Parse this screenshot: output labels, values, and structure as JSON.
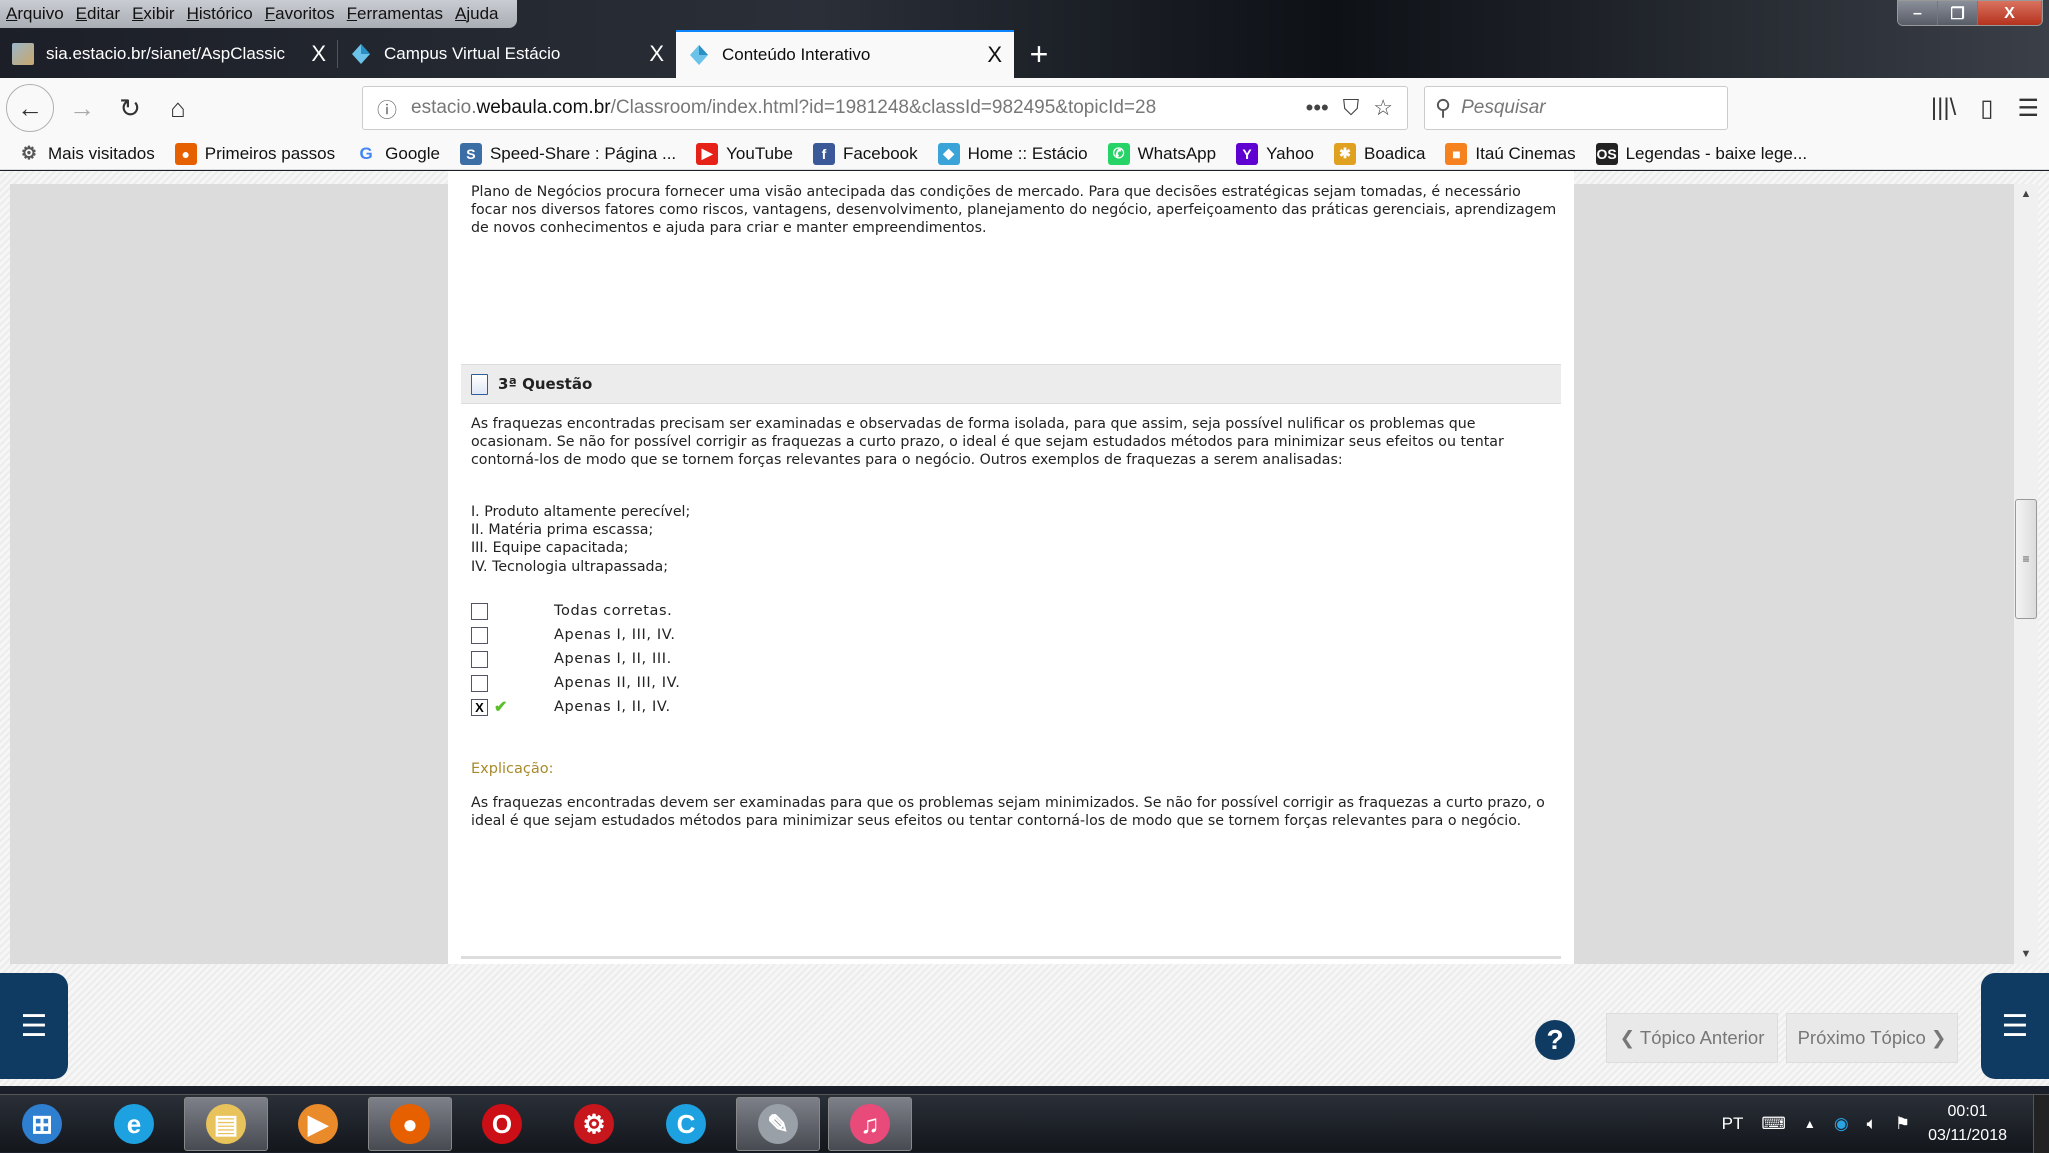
{
  "browser": {
    "menu": [
      "Arquivo",
      "Editar",
      "Exibir",
      "Histórico",
      "Favoritos",
      "Ferramentas",
      "Ajuda"
    ],
    "window_controls": {
      "minimize": "–",
      "restore": "❐",
      "close": "X"
    },
    "tabs": [
      {
        "label": "sia.estacio.br/sianet/AspClassic",
        "close": "X",
        "active": false
      },
      {
        "label": "Campus Virtual Estácio",
        "close": "X",
        "active": false
      },
      {
        "label": "Conteúdo Interativo",
        "close": "X",
        "active": true
      }
    ],
    "new_tab": "+",
    "nav": {
      "back": "←",
      "forward": "→",
      "reload": "C",
      "home": "⌂"
    },
    "url": {
      "prefix": "estacio.",
      "domain": "webaula.com.br",
      "path": "/Classroom/index.html?id=1981248&classId=982495&topicId=28"
    },
    "url_actions": {
      "more": "•••",
      "pocket": "⛉",
      "bookmark": "☆"
    },
    "search": {
      "placeholder": "Pesquisar",
      "icon": "search-icon"
    },
    "toolbar_right": {
      "library": "|||\\",
      "sidebar": "▯",
      "menu": "☰"
    },
    "bookmarks": [
      {
        "label": "Mais visitados",
        "icon": "gear-icon",
        "glyph": "⚙",
        "color": "#555555"
      },
      {
        "label": "Primeiros passos",
        "icon": "firefox-icon",
        "glyph": "●",
        "color": "#e66000"
      },
      {
        "label": "Google",
        "icon": "google-icon",
        "glyph": "G",
        "color": "#4285f4"
      },
      {
        "label": "Speed-Share : Página ...",
        "icon": "speedshare-icon",
        "glyph": "S",
        "color": "#3a6ea5"
      },
      {
        "label": "YouTube",
        "icon": "youtube-icon",
        "glyph": "▶",
        "color": "#e62117"
      },
      {
        "label": "Facebook",
        "icon": "facebook-icon",
        "glyph": "f",
        "color": "#3b5998"
      },
      {
        "label": "Home :: Estácio",
        "icon": "estacio-icon",
        "glyph": "◆",
        "color": "#3aa3d8"
      },
      {
        "label": "WhatsApp",
        "icon": "whatsapp-icon",
        "glyph": "✆",
        "color": "#25d366"
      },
      {
        "label": "Yahoo",
        "icon": "yahoo-icon",
        "glyph": "Y",
        "color": "#5f01d1"
      },
      {
        "label": "Boadica",
        "icon": "boadica-icon",
        "glyph": "✱",
        "color": "#e0a020"
      },
      {
        "label": "Itaú Cinemas",
        "icon": "itau-icon",
        "glyph": "■",
        "color": "#f5821f"
      },
      {
        "label": "Legendas - baixe lege...",
        "icon": "legendas-icon",
        "glyph": "OS",
        "color": "#222222"
      }
    ]
  },
  "page": {
    "intro": "Plano de Negócios procura fornecer uma visão antecipada das condições de mercado. Para que decisões estratégicas sejam tomadas, é necessário focar nos diversos fatores como riscos, vantagens, desenvolvimento, planejamento do negócio, aperfeiçoamento das práticas gerenciais, aprendizagem de novos conhecimentos e ajuda para criar e manter empreendimentos.",
    "question": {
      "title": "3ª Questão",
      "text": "As fraquezas encontradas precisam ser examinadas e observadas de forma isolada, para que assim, seja possível nulificar os problemas que ocasionam. Se não for possível corrigir as fraquezas a curto prazo, o ideal é que sejam estudados métodos para minimizar seus efeitos ou tentar contorná-los de modo que se tornem forças relevantes para o negócio. Outros exemplos de fraquezas a serem analisadas:",
      "items": [
        "I. Produto altamente perecível;",
        "II. Matéria prima escassa;",
        "III. Equipe capacitada;",
        "IV. Tecnologia ultrapassada;"
      ],
      "options": [
        {
          "label": "Todas corretas.",
          "checked": false,
          "correct": false
        },
        {
          "label": "Apenas I, III, IV.",
          "checked": false,
          "correct": false
        },
        {
          "label": "Apenas I, II, III.",
          "checked": false,
          "correct": false
        },
        {
          "label": "Apenas II, III, IV.",
          "checked": false,
          "correct": false
        },
        {
          "label": "Apenas I, II, IV.",
          "checked": true,
          "correct": true
        }
      ],
      "checked_mark": "X",
      "correct_mark": "✔",
      "explanation_label": "Explicação:",
      "explanation": "As fraquezas encontradas devem ser examinadas para que os problemas sejam minimizados. Se não for possível corrigir as fraquezas a curto prazo, o ideal é que sejam estudados métodos para minimizar seus efeitos ou tentar contorná-los de modo que se tornem forças relevantes para o negócio."
    },
    "footer": {
      "help": "?",
      "prev": "❮ Tópico Anterior",
      "next": "Próximo Tópico ❯",
      "menu": "☰"
    },
    "colors": {
      "brand": "#0f3a62",
      "explanation": "#a88a2c",
      "correct": "#5bbf2a"
    }
  },
  "taskbar": {
    "apps": [
      {
        "name": "start-button",
        "glyph": "⊞",
        "color": "#2f7fd1"
      },
      {
        "name": "internet-explorer",
        "glyph": "e",
        "color": "#1ea1e0"
      },
      {
        "name": "file-explorer",
        "glyph": "▤",
        "color": "#e8c25a"
      },
      {
        "name": "media-player",
        "glyph": "▶",
        "color": "#e98b2a"
      },
      {
        "name": "firefox",
        "glyph": "●",
        "color": "#e66000"
      },
      {
        "name": "opera",
        "glyph": "O",
        "color": "#cc0f16"
      },
      {
        "name": "iobit",
        "glyph": "⚙",
        "color": "#c8161d"
      },
      {
        "name": "ccleaner",
        "glyph": "C",
        "color": "#1ea1e0"
      },
      {
        "name": "paint",
        "glyph": "✎",
        "color": "#9aa0a8"
      },
      {
        "name": "itunes",
        "glyph": "♫",
        "color": "#e84b7a"
      }
    ],
    "language": "PT",
    "time": "00:01",
    "date": "03/11/2018"
  }
}
